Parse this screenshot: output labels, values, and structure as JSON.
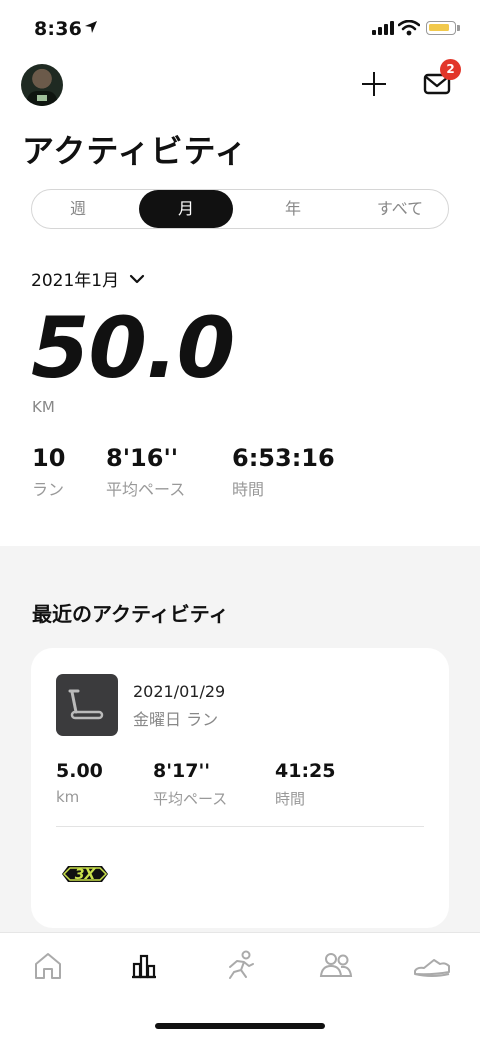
{
  "status_bar": {
    "time": "8:36"
  },
  "header": {
    "notification_count": "2"
  },
  "title": "アクティビティ",
  "segments": [
    "週",
    "月",
    "年",
    "すべて"
  ],
  "selected_segment": "月",
  "period": {
    "label": "2021年1月"
  },
  "summary": {
    "distance": "50.0",
    "unit": "KM",
    "stats": [
      {
        "value": "10",
        "label": "ラン"
      },
      {
        "value": "8'16''",
        "label": "平均ペース"
      },
      {
        "value": "6:53:16",
        "label": "時間"
      }
    ]
  },
  "recent": {
    "heading": "最近のアクティビティ",
    "activity": {
      "date": "2021/01/29",
      "subtitle": "金曜日 ラン",
      "stats": [
        {
          "value": "5.00",
          "label": "km"
        },
        {
          "value": "8'17''",
          "label": "平均ペース"
        },
        {
          "value": "41:25",
          "label": "時間"
        }
      ],
      "achievement_text": "3X"
    }
  },
  "tabs": [
    "home-icon",
    "activity-chart-icon",
    "runner-icon",
    "club-icon",
    "shoe-icon"
  ],
  "colors": {
    "accent": "#111111",
    "badge": "#e2362a",
    "achievement": "#c9e04a"
  }
}
